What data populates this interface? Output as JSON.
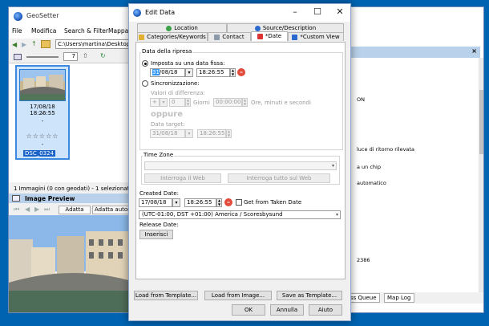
{
  "main_window": {
    "title": "GeoSetter",
    "menu": [
      "File",
      "Modifica",
      "Search & Filter",
      "Mappa"
    ],
    "path": "C:\\Users\\martina\\Desktop",
    "counter": "7",
    "thumbnail": {
      "date": "17/08/18 18:26:55",
      "dash1": "-",
      "dash2": "-",
      "stars": "☆☆☆☆☆",
      "dash3": "-",
      "filename": "DSC_0324"
    },
    "status": "1 Immagini (0 con geodati) - 1 selezionate",
    "preview_title": "Image Preview",
    "preview_buttons": [
      "Adatta",
      "Adatta automa"
    ],
    "right_lines": [
      "ON",
      "luce di ritorno rilevata",
      "a un chip",
      "automatico",
      "2386"
    ],
    "right_tabs": [
      "ss Queue",
      "Map Log"
    ]
  },
  "dialog": {
    "title": "Edit Data",
    "tabs_row1": [
      "Location",
      "Source/Description"
    ],
    "tabs_row2": [
      "Categories/Keywords",
      "Contact",
      "*Date",
      "*Custom View"
    ],
    "active_tab": "*Date",
    "group_label": "Data della ripresa",
    "radio_fixed": "Imposta su una data fissa:",
    "fixed_date_selected": "31",
    "fixed_date_rest": "/08/18",
    "fixed_time": "18:26:55",
    "radio_sync": "Sincronizzazione:",
    "diff_label": "Valori di differenza:",
    "diff_sign": "+",
    "diff_days": "0",
    "days_label": "Giorni",
    "diff_time": "00:00:00",
    "diff_time_label": "Ore, minuti e secondi",
    "oppure": "oppure",
    "target_label": "Data target:",
    "target_date": "31/08/18",
    "target_time": "18:26:55",
    "tz_label": "Time Zone",
    "tz_btn1": "Interroga il Web",
    "tz_btn2": "Interroga tutto sul Web",
    "created_label": "Created Date:",
    "created_date": "17/08/18",
    "created_time": "18:26:55",
    "get_from_taken": "Get from Taken Date",
    "timezone_value": "(UTC-01:00, DST +01:00) America / Scoresbysund",
    "release_label": "Release Date:",
    "insert_btn": "Inserisci",
    "template_btns": [
      "Load from Template...",
      "Load from Image...",
      "Save as Template..."
    ],
    "ok": "OK",
    "cancel": "Annulla",
    "help": "Aiuto"
  },
  "colors": {
    "desktop": "#0063b1",
    "selection": "#3399ff",
    "delete_red": "#e24a3a"
  }
}
